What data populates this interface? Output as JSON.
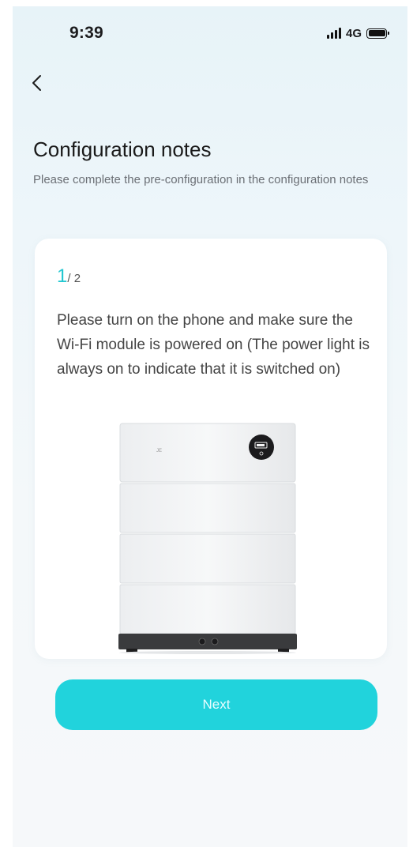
{
  "status_bar": {
    "time": "9:39",
    "network": "4G",
    "battery_level": 1.0
  },
  "nav": {
    "back_icon": "chevron-left-icon"
  },
  "header": {
    "title": "Configuration notes",
    "subtitle": "Please complete the pre-configuration in the configuration notes"
  },
  "card": {
    "step_current": "1",
    "step_total": "/ 2",
    "description": "Please turn on the phone and make sure the Wi-Fi module is powered on (The power light is always on to indicate that it is switched on)",
    "image_icon": "battery-storage-device-image"
  },
  "actions": {
    "next_label": "Next"
  },
  "colors": {
    "accent": "#21d3dc",
    "step_accent": "#22c7d1",
    "background_top": "#e7f3f8",
    "background_bottom": "#f6f8fa"
  }
}
